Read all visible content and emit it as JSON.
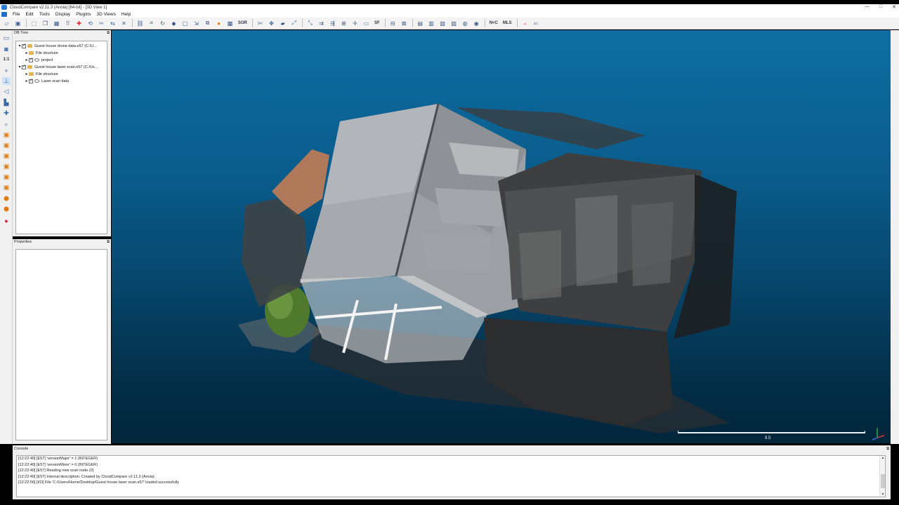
{
  "window": {
    "title": "CloudCompare v2.11.3 (Anoia) [64-bit] - [3D View 1]",
    "controls": [
      "—",
      "□",
      "✕"
    ]
  },
  "menu": [
    "File",
    "Edit",
    "Tools",
    "Display",
    "Plugins",
    "3D Views",
    "Help"
  ],
  "toolbar": {
    "sor_label": "SOR",
    "mls_label": "MLS",
    "nc_label": "N<C"
  },
  "db_tree": {
    "title": "DB Tree",
    "rows": [
      {
        "label": "Guest house drone data.e57 (C:/U..."
      },
      {
        "label": "File structure"
      },
      {
        "label": "project"
      },
      {
        "label": "Guest house laser scan.e57 (C:/Us..."
      },
      {
        "label": "File structure"
      },
      {
        "label": "Laser scan data"
      }
    ]
  },
  "properties": {
    "title": "Properties"
  },
  "console": {
    "title": "Console",
    "lines": [
      "[12:22:40] [E57] 'versionMajor' = 1 (INTEGER)",
      "[12:22:40] [E57] 'versionMinor' = 0 (INTEGER)",
      "[12:22:40] [E57] Reading new scan node (0)",
      "[12:22:40] [E57] Internal description: Created by CloudCompare v2.11.3 (Anoia)",
      "[12:22:56] [I/O] File 'C:/Users/Home/Desktop/Guest house laser scan.e57' loaded successfully"
    ]
  },
  "view3d": {
    "scale_label": "9.5",
    "background_top": "#0e6ea2",
    "background_bottom": "#02253a"
  },
  "icons": {
    "float_icon": "⧉"
  }
}
